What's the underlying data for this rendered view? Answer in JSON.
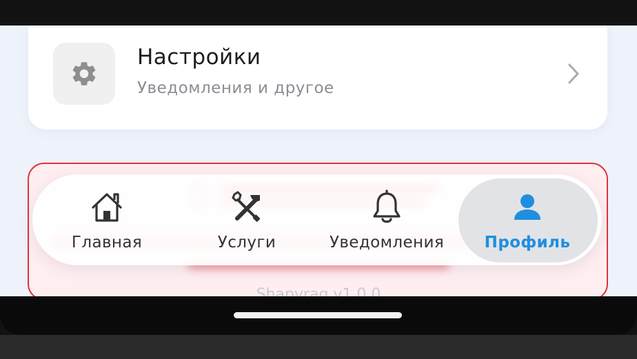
{
  "settings": {
    "title": "Настройки",
    "subtitle": "Уведомления и другое"
  },
  "version_text": "Shapyrag v1.0.0",
  "bottom_nav": {
    "items": [
      {
        "label": "Главная",
        "icon": "home-icon",
        "active": false
      },
      {
        "label": "Услуги",
        "icon": "tools-icon",
        "active": false
      },
      {
        "label": "Уведомления",
        "icon": "bell-icon",
        "active": false
      },
      {
        "label": "Профиль",
        "icon": "user-icon",
        "active": true
      }
    ]
  },
  "colors": {
    "accent": "#1e8fe0",
    "danger": "#e0333a",
    "background": "#eef2fb"
  }
}
